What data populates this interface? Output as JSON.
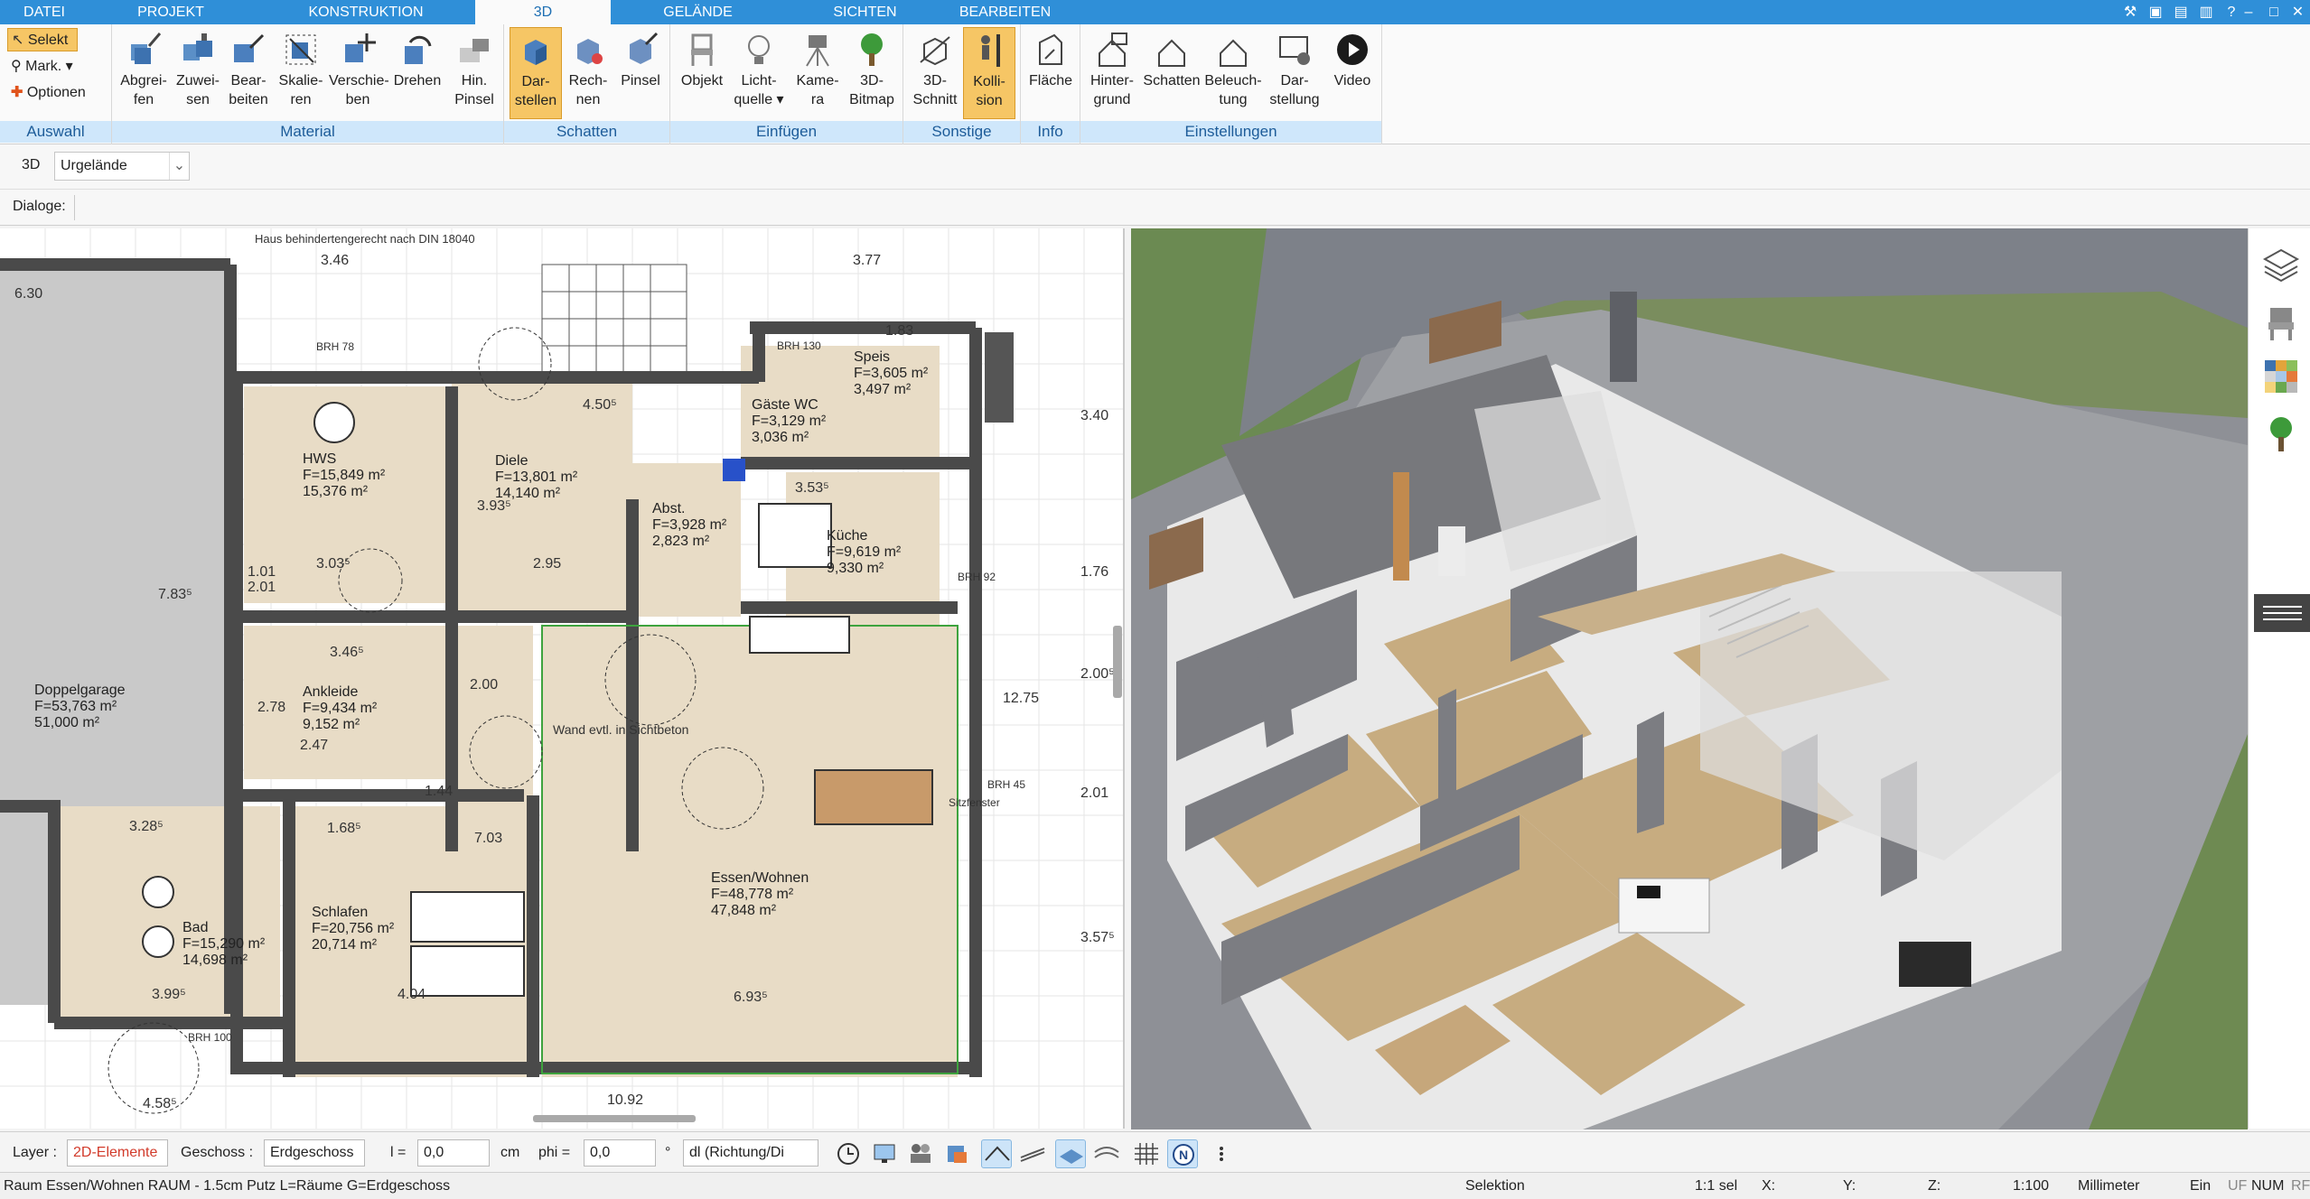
{
  "menu": {
    "tabs": [
      {
        "label": "DATEI",
        "active": false
      },
      {
        "label": "PROJEKT",
        "active": false
      },
      {
        "label": "KONSTRUKTION",
        "active": false
      },
      {
        "label": "3D",
        "active": true
      },
      {
        "label": "GELÄNDE",
        "active": false
      },
      {
        "label": "SICHTEN",
        "active": false
      },
      {
        "label": "BEARBEITEN",
        "active": false
      }
    ],
    "window_controls": [
      "–",
      "□",
      "✕"
    ]
  },
  "ribbon": {
    "auswahl": {
      "select_label": "Selekt",
      "mark_label": "Mark.",
      "options_label": "Optionen",
      "title": "Auswahl"
    },
    "material": {
      "title": "Material",
      "buttons": [
        {
          "line1": "Abgrei-",
          "line2": "fen",
          "icon": "eyedropper-icon"
        },
        {
          "line1": "Zuwei-",
          "line2": "sen",
          "icon": "assign-material-icon"
        },
        {
          "line1": "Bear-",
          "line2": "beiten",
          "icon": "edit-material-icon"
        },
        {
          "line1": "Skalie-",
          "line2": "ren",
          "icon": "scale-icon"
        },
        {
          "line1": "Verschie-",
          "line2": "ben",
          "icon": "move-icon"
        },
        {
          "line1": "Drehen",
          "line2": "",
          "icon": "rotate-icon"
        },
        {
          "line1": "Hin.",
          "line2": "Pinsel",
          "icon": "brush-icon"
        }
      ]
    },
    "schatten": {
      "title": "Schatten",
      "buttons": [
        {
          "line1": "Dar-",
          "line2": "stellen",
          "icon": "shadow-display-icon",
          "selected": true
        },
        {
          "line1": "Rech-",
          "line2": "nen",
          "icon": "shadow-calc-icon",
          "selected": false
        },
        {
          "line1": "Pinsel",
          "line2": "",
          "icon": "shadow-brush-icon",
          "selected": false
        }
      ]
    },
    "einfuegen": {
      "title": "Einfügen",
      "buttons": [
        {
          "line1": "Objekt",
          "line2": "",
          "icon": "chair-icon"
        },
        {
          "line1": "Licht-",
          "line2": "quelle ▾",
          "icon": "lightbulb-icon"
        },
        {
          "line1": "Kame-",
          "line2": "ra",
          "icon": "camera-icon"
        },
        {
          "line1": "3D-",
          "line2": "Bitmap",
          "icon": "tree-icon"
        }
      ]
    },
    "sonstige": {
      "title": "Sonstige",
      "buttons": [
        {
          "line1": "3D-",
          "line2": "Schnitt",
          "icon": "section-icon",
          "selected": false
        },
        {
          "line1": "Kolli-",
          "line2": "sion",
          "icon": "collision-icon",
          "selected": true
        }
      ]
    },
    "info": {
      "title": "Info",
      "buttons": [
        {
          "line1": "Fläche",
          "line2": "",
          "icon": "area-icon"
        }
      ]
    },
    "einstellungen": {
      "title": "Einstellungen",
      "buttons": [
        {
          "line1": "Hinter-",
          "line2": "grund",
          "icon": "background-icon"
        },
        {
          "line1": "Schatten",
          "line2": "",
          "icon": "shadow-settings-icon"
        },
        {
          "line1": "Beleuch-",
          "line2": "tung",
          "icon": "lighting-icon"
        },
        {
          "line1": "Dar-",
          "line2": "stellung",
          "icon": "display-icon"
        },
        {
          "line1": "Video",
          "line2": "",
          "icon": "play-icon"
        }
      ]
    }
  },
  "row2": {
    "mode_label": "3D",
    "terrain_select": "Urgelände"
  },
  "row3": {
    "dialog_label": "Dialoge:"
  },
  "plan": {
    "rooms": [
      {
        "name": "HWS",
        "area1": "F=15,849 m²",
        "area2": "15,376 m²"
      },
      {
        "name": "Diele",
        "area1": "F=13,801 m²",
        "area2": "14,140 m²"
      },
      {
        "name": "Speis",
        "area1": "F=3,605 m²",
        "area2": "3,497 m²"
      },
      {
        "name": "Gäste WC",
        "area1": "F=3,129 m²",
        "area2": "3,036 m²"
      },
      {
        "name": "Abst.",
        "area1": "F=3,928 m²",
        "area2": "2,823 m²"
      },
      {
        "name": "Küche",
        "area1": "F=9,619 m²",
        "area2": "9,330 m²"
      },
      {
        "name": "Ankleide",
        "area1": "F=9,434 m²",
        "area2": "9,152 m²"
      },
      {
        "name": "Doppelgarage",
        "area1": "F=53,763 m²",
        "area2": "51,000 m²"
      },
      {
        "name": "Schlafen",
        "area1": "F=20,756 m²",
        "area2": "20,714 m²"
      },
      {
        "name": "Bad",
        "area1": "F=15,290 m²",
        "area2": "14,698 m²"
      },
      {
        "name": "Essen/Wohnen",
        "area1": "F=48,778 m²",
        "area2": "47,848 m²"
      }
    ],
    "dimensions": [
      "3.46",
      "6.30",
      "3.77",
      "1.83",
      "4.50⁵",
      "2.95",
      "3.03⁵",
      "3.53⁵",
      "3.46⁵",
      "2.78",
      "2.47",
      "1.44",
      "7.03",
      "1.68⁵",
      "3.28⁵",
      "3.99⁵",
      "4.04",
      "6.93⁵",
      "4.58⁵",
      "10.92",
      "12.75",
      "3.40",
      "1.76",
      "2.00⁵",
      "2.01",
      "3.57⁵",
      "7.83⁵",
      "3.93⁵",
      "1.01",
      "2.01",
      "2.00"
    ],
    "notes": [
      "Haus behindertengerecht nach DIN 18040",
      "Wand evtl. in Sichtbeton",
      "BRH 78",
      "BRH 130",
      "BRH 100",
      "BRH 45",
      "BRH 92",
      "Sitzfenster"
    ]
  },
  "bottombar": {
    "layer_label": "Layer :",
    "layer_value": "2D-Elemente",
    "storey_label": "Geschoss :",
    "storey_value": "Erdgeschoss",
    "l_label": "l =",
    "l_value": "0,0",
    "l_unit": "cm",
    "phi_label": "phi =",
    "phi_value": "0,0",
    "phi_unit": "°",
    "direction_value": "dl (Richtung/Di"
  },
  "statusbar": {
    "left": "Raum Essen/Wohnen RAUM - 1.5cm Putz L=Räume G=Erdgeschoss",
    "mode": "Selektion",
    "sel": "1:1 sel",
    "x_label": "X:",
    "y_label": "Y:",
    "z_label": "Z:",
    "scale": "1:100",
    "unit": "Millimeter",
    "ein": "Ein",
    "uf": "UF",
    "num": "NUM",
    "rf": "RF"
  },
  "colors": {
    "accent": "#2f8fd8",
    "ribbon_group": "#cfe7fb",
    "selected": "#f6c665",
    "floor": "#e8dcc6",
    "grass": "#7a8d5e"
  }
}
